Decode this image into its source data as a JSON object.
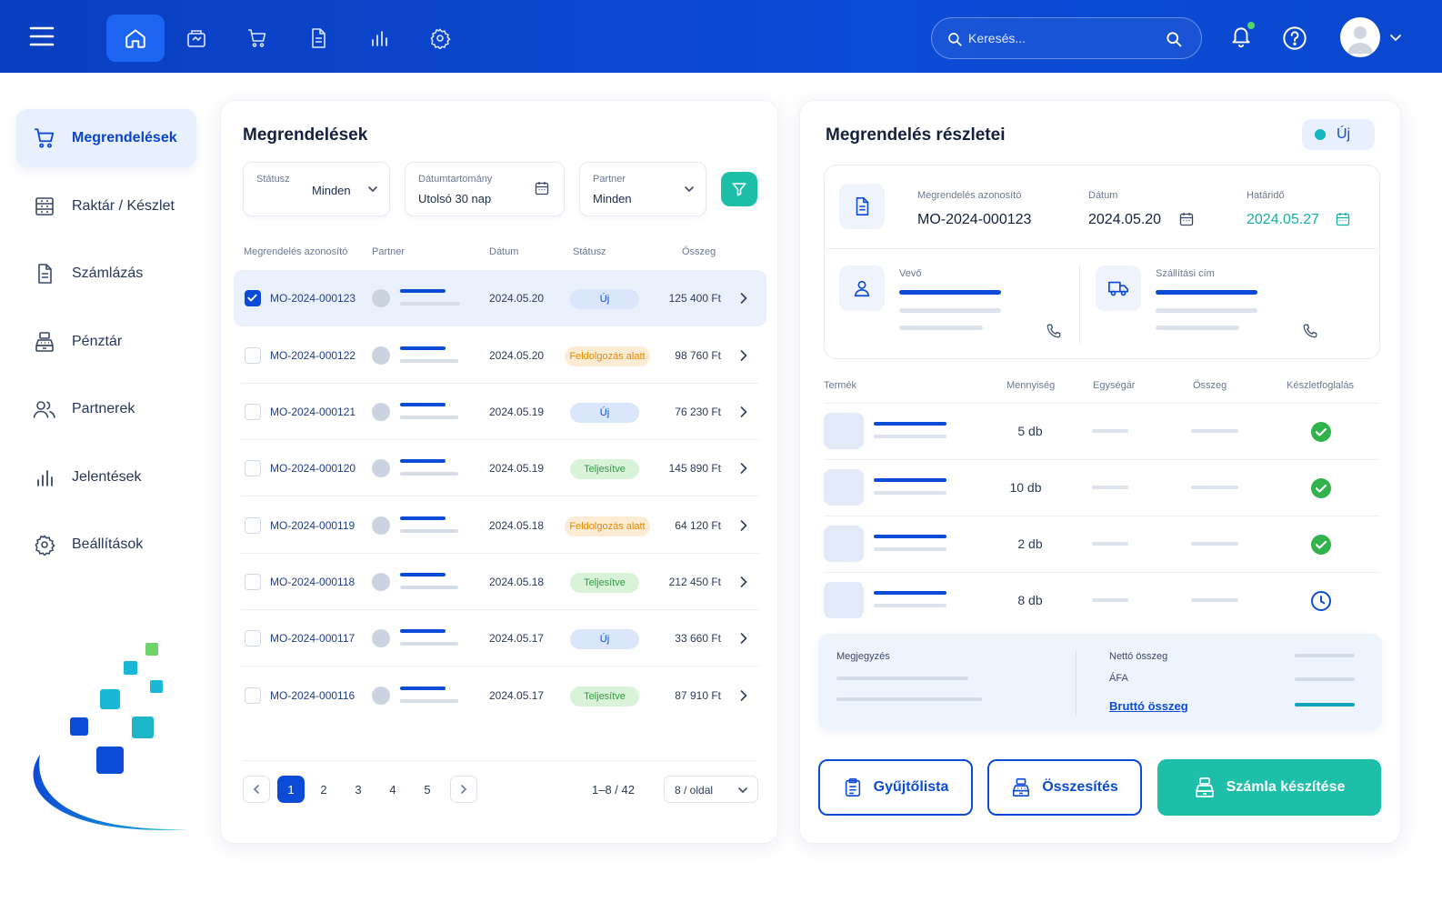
{
  "header": {
    "search_placeholder": "Keresés...",
    "nav_icons": [
      "home-icon",
      "box-icon",
      "cart-icon",
      "document-icon",
      "chart-icon",
      "gear-icon"
    ],
    "active_nav": "home-icon",
    "notification_dot_color": "#59d36c"
  },
  "sidebar": {
    "items": [
      {
        "label": "Megrendelések",
        "icon": "cart-icon",
        "active": true
      },
      {
        "label": "Raktár / Készlet",
        "icon": "warehouse-icon"
      },
      {
        "label": "Számlázás",
        "icon": "invoice-icon"
      },
      {
        "label": "Pénztár",
        "icon": "register-icon"
      },
      {
        "label": "Partnerek",
        "icon": "users-icon"
      },
      {
        "label": "Jelentések",
        "icon": "chart-icon"
      },
      {
        "label": "Beállítások",
        "icon": "gear-icon"
      }
    ]
  },
  "orders": {
    "title": "Megrendelések",
    "filters": {
      "status_label": "Státusz",
      "status_value": "Minden",
      "date_label": "Dátumtartomány",
      "date_value": "Utolsó 30 nap",
      "partner_label": "Partner",
      "partner_value": "Minden"
    },
    "columns": [
      "Megrendelés azonosító",
      "Partner",
      "Dátum",
      "Státusz",
      "Összeg"
    ],
    "rows": [
      {
        "id": "MO-2024-000123",
        "date": "2024.05.20",
        "status": "Új",
        "amount": "125 400 Ft",
        "selected": true
      },
      {
        "id": "MO-2024-000122",
        "date": "2024.05.20",
        "status": "Feldolgozás alatt",
        "amount": "98 760 Ft"
      },
      {
        "id": "MO-2024-000121",
        "date": "2024.05.19",
        "status": "Új",
        "amount": "76 230 Ft"
      },
      {
        "id": "MO-2024-000120",
        "date": "2024.05.19",
        "status": "Teljesítve",
        "amount": "145 890 Ft"
      },
      {
        "id": "MO-2024-000119",
        "date": "2024.05.18",
        "status": "Feldolgozás alatt",
        "amount": "64 120 Ft"
      },
      {
        "id": "MO-2024-000118",
        "date": "2024.05.18",
        "status": "Teljesítve",
        "amount": "212 450 Ft"
      },
      {
        "id": "MO-2024-000117",
        "date": "2024.05.17",
        "status": "Új",
        "amount": "33 660 Ft"
      },
      {
        "id": "MO-2024-000116",
        "date": "2024.05.17",
        "status": "Teljesítve",
        "amount": "87 910 Ft"
      }
    ],
    "pagination": {
      "pages": [
        "1",
        "2",
        "3",
        "4",
        "5"
      ],
      "current": "1",
      "info": "1–8 / 42",
      "page_size": "8 / oldal"
    }
  },
  "details": {
    "title": "Megrendelés részletei",
    "status": "Új",
    "id_label": "Megrendelés azonosító",
    "id_value": "MO-2024-000123",
    "date_label": "Dátum",
    "date_value": "2024.05.20",
    "deadline_label": "Határidő",
    "deadline_value": "2024.05.27",
    "buyer_label": "Vevő",
    "shipping_label": "Szállítási cím",
    "product_columns": [
      "Termék",
      "Mennyiség",
      "Egységár",
      "Összeg",
      "Készletfoglalás"
    ],
    "products": [
      {
        "qty": "5 db",
        "reservation": "check-circle-icon"
      },
      {
        "qty": "10 db",
        "reservation": "check-circle-icon"
      },
      {
        "qty": "2 db",
        "reservation": "check-circle-icon"
      },
      {
        "qty": "8 db",
        "reservation": "clock-icon"
      }
    ],
    "note_label": "Megjegyzés",
    "net_label": "Nettó összeg",
    "vat_label": "ÁFA",
    "gross_label": "Bruttó összeg",
    "buttons": {
      "collect": "Gyűjtőlista",
      "summary": "Összesítés",
      "invoice": "Számla készítése"
    }
  },
  "colors": {
    "primary": "#0c4bd6",
    "teal": "#1dbfa9",
    "success": "#2fb34a",
    "warning": "#e58a00"
  }
}
